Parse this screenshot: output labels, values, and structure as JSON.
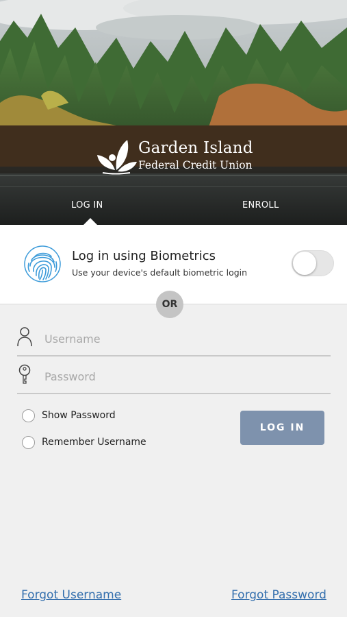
{
  "brand": {
    "name": "Garden Island",
    "subtitle": "Federal Credit Union"
  },
  "tabs": [
    {
      "label": "LOG IN",
      "active": true
    },
    {
      "label": "ENROLL",
      "active": false
    }
  ],
  "biometrics": {
    "title": "Log in using Biometrics",
    "subtitle": "Use your device's default biometric login",
    "enabled": false
  },
  "divider": {
    "label": "OR"
  },
  "form": {
    "username": {
      "placeholder": "Username",
      "value": ""
    },
    "password": {
      "placeholder": "Password",
      "value": ""
    },
    "show_password": {
      "label": "Show Password",
      "checked": false
    },
    "remember_username": {
      "label": "Remember Username",
      "checked": false
    },
    "login_button": "LOG IN"
  },
  "links": {
    "forgot_username": "Forgot Username",
    "forgot_password": "Forgot Password"
  },
  "colors": {
    "button": "#7e92ad",
    "link": "#3570ae",
    "fingerprint": "#3a9ad9"
  },
  "icons": {
    "username": "user-icon",
    "password": "key-icon",
    "biometric": "fingerprint-icon",
    "logo": "leaf-icon"
  }
}
